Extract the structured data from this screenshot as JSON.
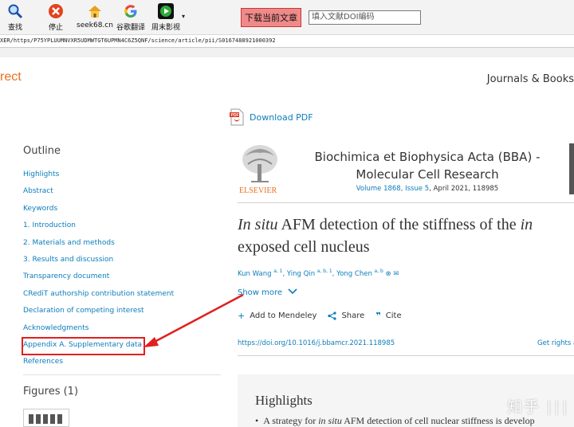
{
  "toolbar": {
    "buttons": [
      {
        "label": "查找",
        "icon": "magnifier-icon"
      },
      {
        "label": "停止",
        "icon": "stop-icon"
      },
      {
        "label": "seek68.cn",
        "icon": "home-icon"
      },
      {
        "label": "谷歌翻译",
        "icon": "google-icon"
      },
      {
        "label": "周末影视",
        "icon": "play-icon"
      }
    ],
    "dropdown_glyph": "▾",
    "download_current": "下载当前文章",
    "doi_placeholder": "填入文献DOI编码"
  },
  "url": "XER/https/P75YPLUUMNVXR5UDMWTGT6UPMN4C6Z5QNF/science/article/pii/S0167488921000392",
  "site": {
    "logo_text": "rect",
    "nav_label": "Journals & Books"
  },
  "download_pdf": "Download PDF",
  "outline": {
    "title": "Outline",
    "items": [
      "Highlights",
      "Abstract",
      "Keywords",
      "1. Introduction",
      "2. Materials and methods",
      "3. Results and discussion",
      "Transparency document",
      "CRediT authorship contribution statement",
      "Declaration of competing interest",
      "Acknowledgments",
      "Appendix A. Supplementary data",
      "References"
    ],
    "figures_title": "Figures (1)"
  },
  "journal": {
    "publisher": "ELSEVIER",
    "title": "Biochimica et Biophysica Acta (BBA) - Molecular Cell Research",
    "volume_link": "Volume 1868, Issue 5",
    "date_id": ", April 2021, 118985"
  },
  "article": {
    "title_italic": "In situ",
    "title_rest": " AFM detection of the stiffness of the ",
    "title_italic_tail": "in",
    "title_line2": "exposed cell nucleus",
    "authors": [
      {
        "name": "Kun Wang",
        "sup": "a, 1"
      },
      {
        "name": "Ying Qin",
        "sup": "a, b, 1"
      },
      {
        "name": "Yong Chen",
        "sup": "a, b"
      }
    ],
    "show_more": "Show more",
    "actions": {
      "mendeley": "Add to Mendeley",
      "share": "Share",
      "cite": "Cite"
    },
    "doi_url": "https://doi.org/10.1016/j.bbamcr.2021.118985",
    "rights": "Get rights a"
  },
  "highlights": {
    "title": "Highlights",
    "bullet": "•",
    "item_pre": "A strategy for ",
    "item_italic": "in situ",
    "item_post": " AFM detection of cell nuclear stiffness is develop"
  },
  "watermark": "知乎"
}
